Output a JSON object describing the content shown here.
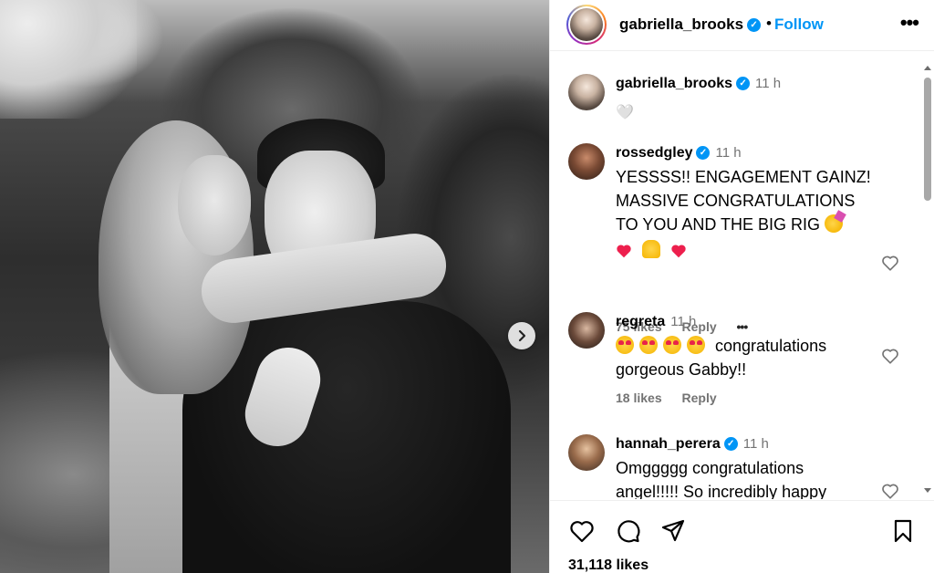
{
  "header": {
    "username": "gabriella_brooks",
    "separator": "•",
    "follow_label": "Follow",
    "more_label": "•••"
  },
  "caption": {
    "username": "gabriella_brooks",
    "time": "11 h",
    "text": "🤍"
  },
  "comments": [
    {
      "username": "rossedgley",
      "time": "11 h",
      "line1": "YESSSS!! ENGAGEMENT GAINZ!",
      "line2": "MASSIVE CONGRATULATIONS",
      "line3": "TO YOU AND THE BIG RIG",
      "emoji_line": [
        "heart",
        "raising-hands",
        "heart"
      ],
      "likes": "75 likes",
      "reply": "Reply",
      "more": "•••"
    },
    {
      "username": "regreta",
      "time": "11 h",
      "line1": "congratulations",
      "line2": "gorgeous Gabby!!",
      "likes": "18 likes",
      "reply": "Reply"
    },
    {
      "username": "hannah_perera",
      "time": "11 h",
      "line1": "Omggggg congratulations",
      "line2": "angel!!!!! So incredibly happy"
    }
  ],
  "actions": {
    "like_icon": "heart-outline-icon",
    "comment_icon": "comment-icon",
    "share_icon": "paper-plane-icon",
    "save_icon": "bookmark-icon"
  },
  "likes_count": "31,118 likes",
  "colors": {
    "accent": "#0095f6",
    "meta": "#737373",
    "heart": "#ed1f4d"
  }
}
